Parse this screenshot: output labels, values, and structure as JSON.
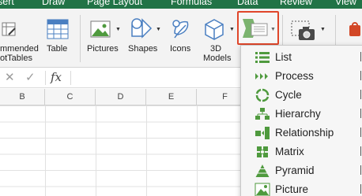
{
  "tabs": [
    {
      "label": "sert"
    },
    {
      "label": "Draw"
    },
    {
      "label": "Page Layout"
    },
    {
      "label": "Formulas"
    },
    {
      "label": "Data"
    },
    {
      "label": "Review"
    },
    {
      "label": "View"
    }
  ],
  "ribbon": {
    "recommended_line1": "mmended",
    "recommended_line2": "otTables",
    "table": "Table",
    "pictures": "Pictures",
    "shapes": "Shapes",
    "icons": "Icons",
    "models_line1": "3D",
    "models_line2": "Models"
  },
  "formula_bar": {
    "cancel_symbol": "✕",
    "enter_symbol": "✓",
    "fx": "fx"
  },
  "columns": [
    "B",
    "C",
    "D",
    "E",
    "F"
  ],
  "smartart_menu": {
    "items": [
      {
        "label": "List",
        "icon": "list-icon"
      },
      {
        "label": "Process",
        "icon": "process-icon"
      },
      {
        "label": "Cycle",
        "icon": "cycle-icon"
      },
      {
        "label": "Hierarchy",
        "icon": "hierarchy-icon"
      },
      {
        "label": "Relationship",
        "icon": "relationship-icon"
      },
      {
        "label": "Matrix",
        "icon": "matrix-icon"
      },
      {
        "label": "Pyramid",
        "icon": "pyramid-icon"
      },
      {
        "label": "Picture",
        "icon": "picture-icon"
      }
    ]
  },
  "colors": {
    "tab_bar": "#217346",
    "accent_green": "#4f9a3e",
    "highlight_border": "#e0462a",
    "office_orange": "#d24726"
  }
}
